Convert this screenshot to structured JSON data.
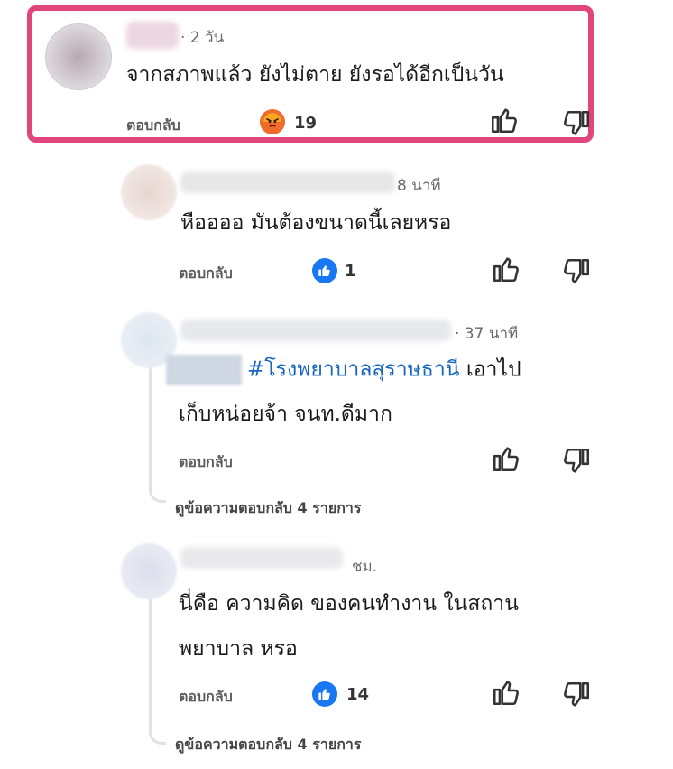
{
  "comments": [
    {
      "time": "· 2 วัน",
      "text": "จากสภาพแล้ว ยังไม่ตาย ยังรอได้อีกเป็นวัน",
      "reply_label": "ตอบกลับ",
      "reaction": {
        "icon": "angry-reaction-icon",
        "count": "19"
      }
    },
    {
      "time": "8 นาที",
      "text": "หืออออ มันต้องขนาดนี้เลยหรอ",
      "reply_label": "ตอบกลับ",
      "reaction": {
        "icon": "like-reaction-icon",
        "count": "1"
      }
    },
    {
      "time": "· 37 นาที",
      "hashtag": "#โรงพยาบาลสุราษธานี",
      "text_line1_rest": "เอาไป",
      "text_line2": "เก็บหน่อยจ้า จนท.ดีมาก",
      "reply_label": "ตอบกลับ",
      "view_replies": "ดูข้อความตอบกลับ 4 รายการ"
    },
    {
      "time": "ชม.",
      "text_line1": "นี่คือ ความคิด ของคนทำงาน ในสถาน",
      "text_line2": "พยาบาล หรอ",
      "reply_label": "ตอบกลับ",
      "reaction": {
        "icon": "like-reaction-icon",
        "count": "14"
      },
      "view_replies": "ดูข้อความตอบกลับ 4 รายการ"
    }
  ],
  "colors": {
    "highlight": "#e0457b",
    "hashtag": "#1565c0",
    "like": "#1877f2",
    "angry": "#f06a2a"
  }
}
